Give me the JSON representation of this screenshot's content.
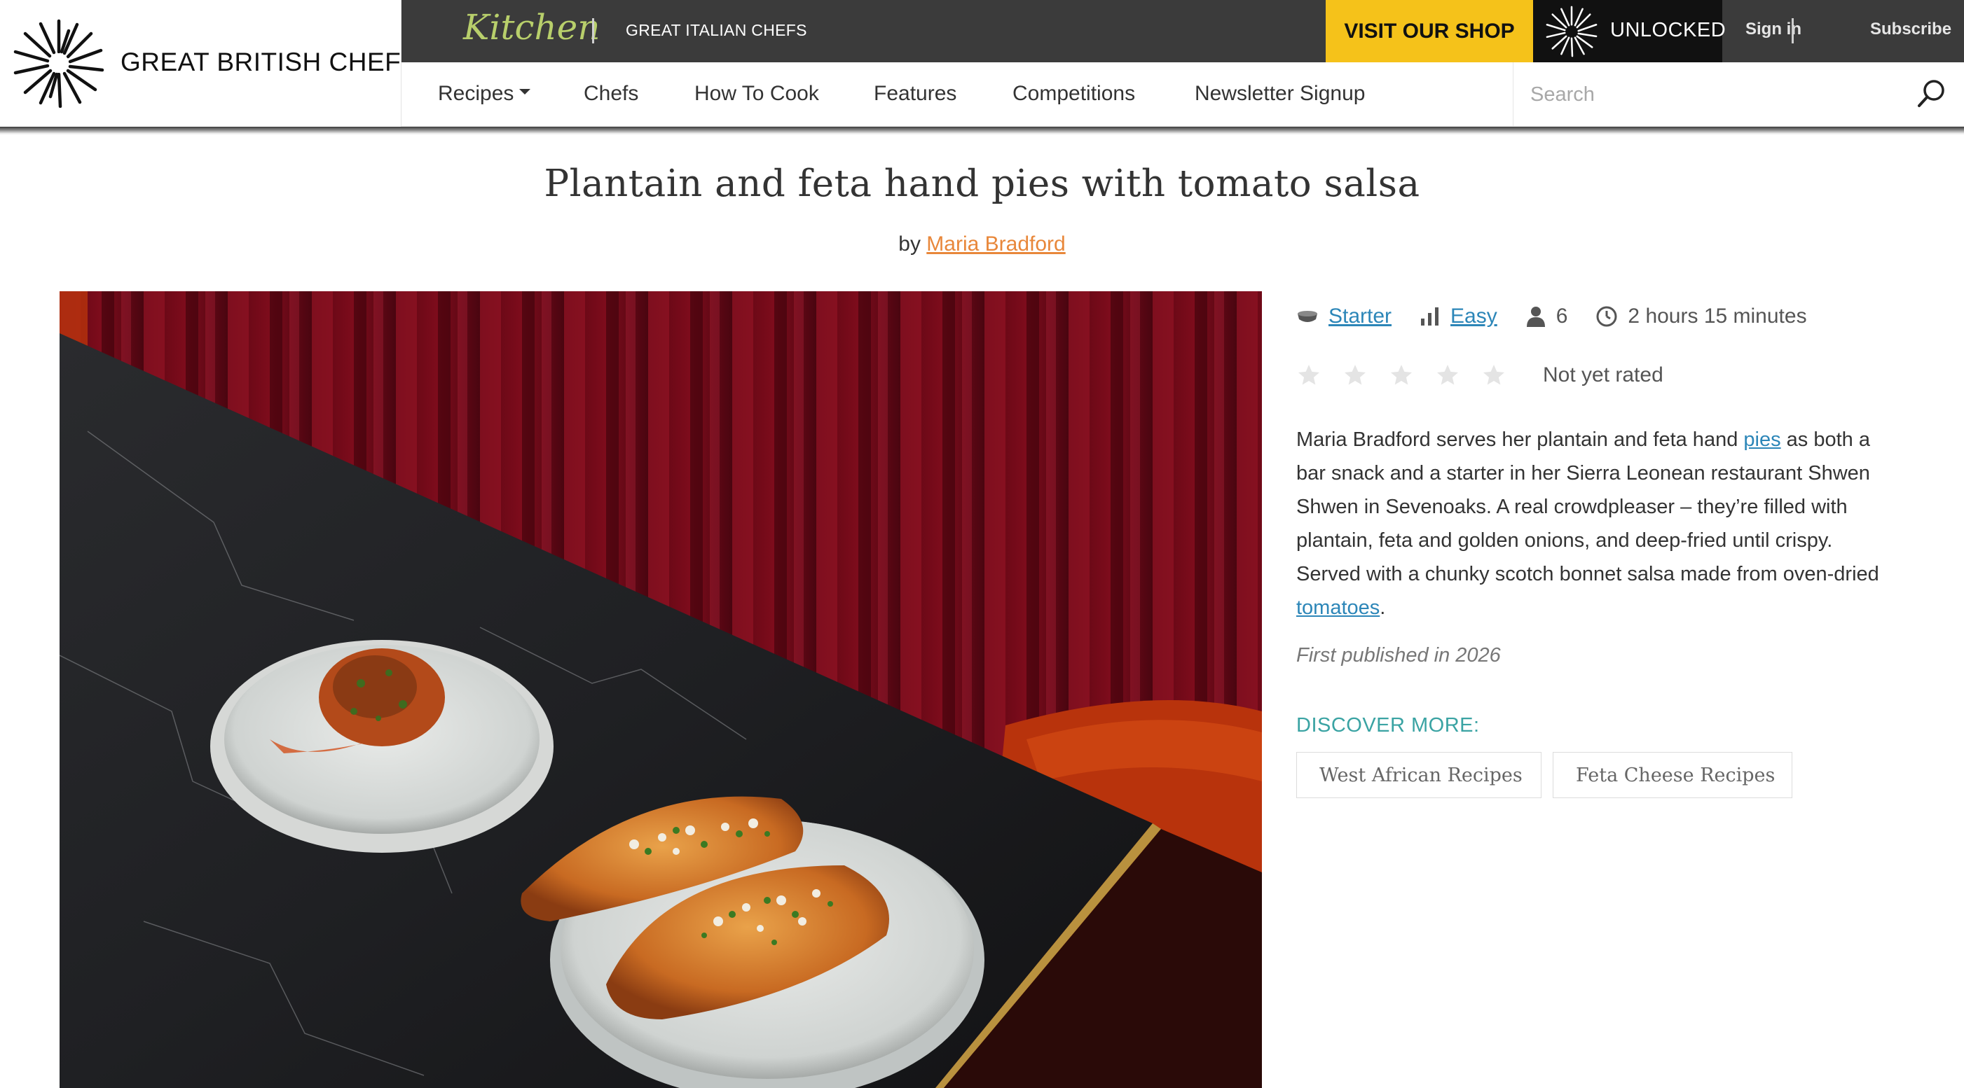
{
  "brand": {
    "name": "GREAT BRITISH CHEFS"
  },
  "topbar": {
    "kitchen_label": "Kitchen",
    "italian_label": "GREAT ITALIAN CHEFS",
    "shop_label": "VISIT OUR SHOP",
    "unlocked_label": "UNLOCKED",
    "signin_label": "Sign in",
    "subscribe_label": "Subscribe",
    "shop_color": "#f5c21a"
  },
  "nav": {
    "items": [
      {
        "label": "Recipes"
      },
      {
        "label": "Chefs"
      },
      {
        "label": "How To Cook"
      },
      {
        "label": "Features"
      },
      {
        "label": "Competitions"
      },
      {
        "label": "Newsletter Signup"
      }
    ],
    "search_placeholder": "Search"
  },
  "recipe": {
    "title": "Plantain and feta hand pies with tomato salsa",
    "by": "by",
    "author": "Maria Bradford",
    "course": "Starter",
    "difficulty": "Easy",
    "serves": "6",
    "time": "2 hours 15 minutes",
    "rating_text": "Not yet rated",
    "stars_filled": 0,
    "stars_total": 5,
    "desc": {
      "p1": "Maria Bradford serves her plantain and feta hand ",
      "link1": "pies",
      "p2": " as both a bar snack and a starter in her Sierra Leonean restaurant Shwen Shwen in Sevenoaks. A real crowdpleaser – they’re filled with plantain, feta and golden onions, and deep-fried until crispy. Served with a chunky scotch bonnet salsa made from oven-dried ",
      "link2": "tomatoes",
      "p3": "."
    },
    "published": "First published in 2026",
    "discover_label": "DISCOVER MORE:",
    "tags": [
      "West African Recipes",
      "Feta Cheese Recipes"
    ]
  },
  "colors": {
    "link": "#2c86b8",
    "author": "#e8873a",
    "discover": "#3aa3a3",
    "topbar": "#3b3b3b"
  }
}
